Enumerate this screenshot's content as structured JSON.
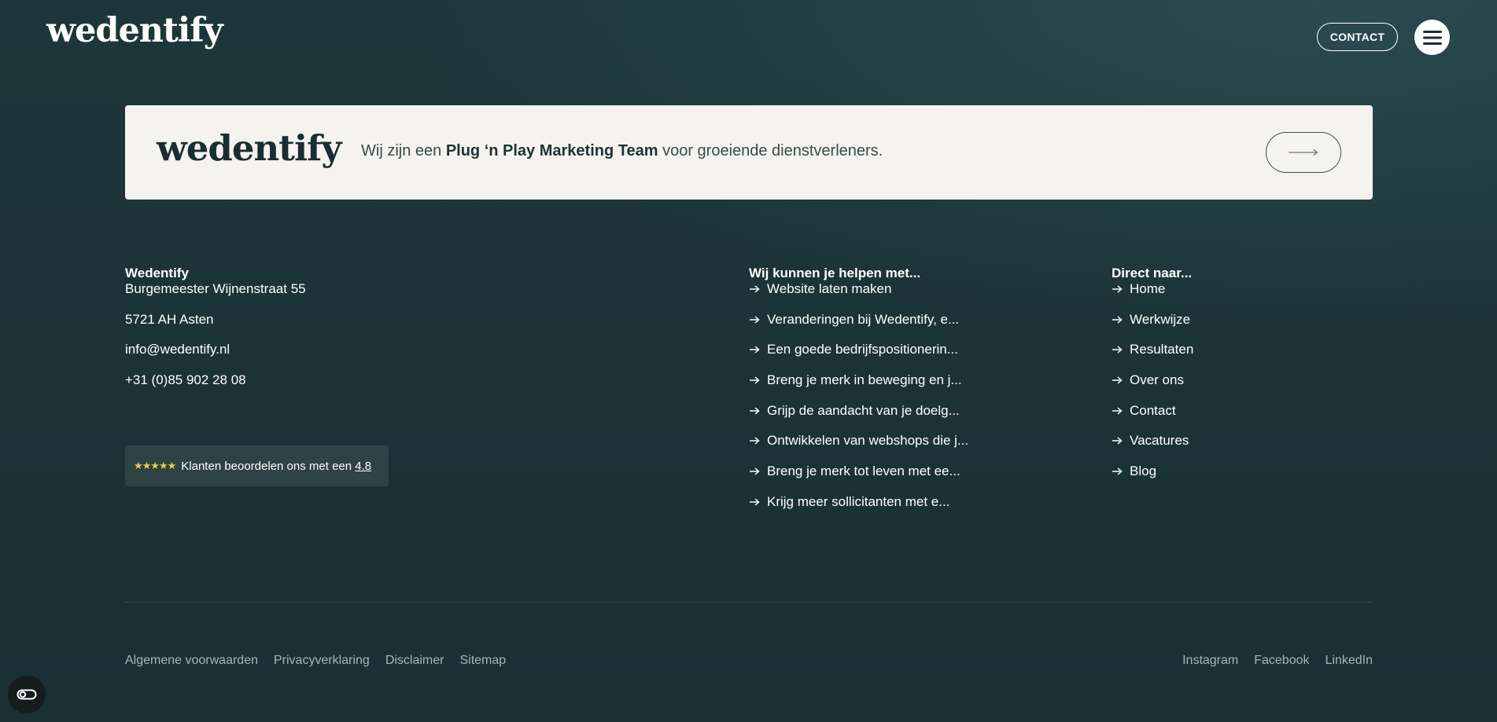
{
  "header": {
    "logo": "wedentify",
    "contact_label": "CONTACT"
  },
  "banner": {
    "logo": "wedentify",
    "text_before": "Wij zijn een ",
    "text_bold": "Plug ‘n Play Marketing Team",
    "text_after": " voor groeiende dienstverleners."
  },
  "company": {
    "title": "Wedentify",
    "lines": [
      "Burgemeester Wijnenstraat 55",
      "5721 AH Asten",
      "info@wedentify.nl",
      "+31 (0)85 902 28 08"
    ]
  },
  "rating": {
    "stars": "★★★★★",
    "text": "Klanten beoordelen ons met een ",
    "value": "4.8"
  },
  "services": {
    "title": "Wij kunnen je helpen met...",
    "items": [
      "Website laten maken",
      "Veranderingen bij Wedentify, e...",
      "Een goede bedrijfspositionerin...",
      "Breng je merk in beweging en j...",
      "Grijp de aandacht van je doelg...",
      "Ontwikkelen van webshops die j...",
      "Breng je merk tot leven met ee...",
      "Krijg meer sollicitanten met e..."
    ]
  },
  "direct": {
    "title": "Direct naar...",
    "items": [
      "Home",
      "Werkwijze",
      "Resultaten",
      "Over ons",
      "Contact",
      "Vacatures",
      "Blog"
    ]
  },
  "footer": {
    "legal": [
      "Algemene voorwaarden",
      "Privacyverklaring",
      "Disclaimer",
      "Sitemap"
    ],
    "social": [
      "Instagram",
      "Facebook",
      "LinkedIn"
    ]
  },
  "icons": {
    "menu": "hamburger-menu-icon",
    "arrow": "arrow-right-icon",
    "cookie": "cookie-settings-icon"
  },
  "colors": {
    "background": "#1c3437",
    "banner_bg": "#f5f3ef",
    "star": "#f5c83c"
  }
}
